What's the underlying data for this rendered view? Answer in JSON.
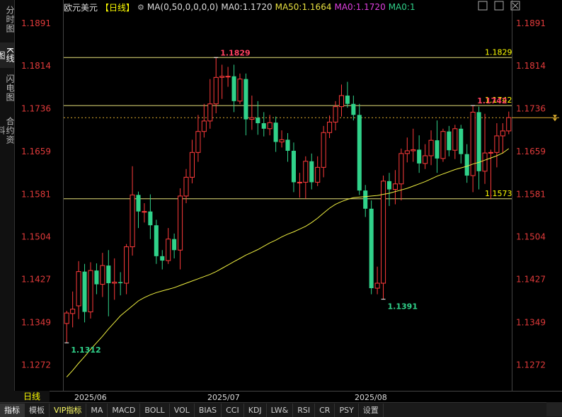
{
  "left_tabs": [
    {
      "label": "分时图",
      "active": false
    },
    {
      "label": "K线图",
      "active": true
    },
    {
      "label": "闪电图",
      "active": false
    },
    {
      "label": "合约资料",
      "active": false
    }
  ],
  "header": {
    "name": "欧元美元",
    "period": "【日线】",
    "ma_label": "MA(0,50,0,0,0,0)",
    "ma0_a": "MA0:1.1720",
    "ma50": "MA50:1.1664",
    "ma0_b": "MA0:1.1720",
    "ma0_c": "MA0:1"
  },
  "window_icons": [
    "maximize-icon",
    "restore-icon",
    "close-icon"
  ],
  "period_label": "日线",
  "bottom_tabs": [
    "指标",
    "模板",
    "VIP指标",
    "MA",
    "MACD",
    "BOLL",
    "VOL",
    "BIAS",
    "CCI",
    "KDJ",
    "LW&",
    "RSI",
    "CR",
    "PSY",
    "设置"
  ],
  "colors": {
    "up": "#ff3b3b",
    "down": "#30d28a",
    "ma": "#f0f040",
    "axis": "#e03a3a",
    "hline": "#e6e07a",
    "label_up": "#ff4060",
    "label_down": "#30d28a"
  },
  "chart_data": {
    "type": "candlestick",
    "y_ticks": [
      "1.1891",
      "1.1814",
      "1.1736",
      "1.1659",
      "1.1581",
      "1.1504",
      "1.1427",
      "1.1349",
      "1.1272"
    ],
    "ylim": [
      1.1235,
      1.192
    ],
    "x_labels": [
      "2025/06",
      "2025/07",
      "2025/08"
    ],
    "hlines": [
      {
        "value": 1.1829,
        "label": "1.1829"
      },
      {
        "value": 1.1742,
        "label": "1.1742"
      },
      {
        "value": 1.1573,
        "label": "1.1573"
      }
    ],
    "current_price": 1.172,
    "annotations": [
      {
        "text": "1.1829",
        "type": "high"
      },
      {
        "text": "1.1742",
        "type": "high"
      },
      {
        "text": "1.1391",
        "type": "low"
      },
      {
        "text": "1.1312",
        "type": "low"
      }
    ],
    "candles": [
      [
        1.1347,
        1.1366,
        1.1312,
        1.137
      ],
      [
        1.1365,
        1.1373,
        1.134,
        1.1405
      ],
      [
        1.1379,
        1.1441,
        1.1355,
        1.146
      ],
      [
        1.1441,
        1.1368,
        1.1349,
        1.1455
      ],
      [
        1.1368,
        1.1443,
        1.1356,
        1.1458
      ],
      [
        1.1443,
        1.1418,
        1.14,
        1.1456
      ],
      [
        1.1418,
        1.1452,
        1.1395,
        1.1475
      ],
      [
        1.1452,
        1.142,
        1.136,
        1.148
      ],
      [
        1.142,
        1.1422,
        1.139,
        1.1465
      ],
      [
        1.1422,
        1.142,
        1.1398,
        1.144
      ],
      [
        1.142,
        1.1486,
        1.14,
        1.1491
      ],
      [
        1.1486,
        1.158,
        1.147,
        1.1632
      ],
      [
        1.158,
        1.155,
        1.152,
        1.1586
      ],
      [
        1.155,
        1.155,
        1.153,
        1.1565
      ],
      [
        1.155,
        1.1525,
        1.15,
        1.1581
      ],
      [
        1.1525,
        1.1469,
        1.1455,
        1.1535
      ],
      [
        1.1469,
        1.1461,
        1.1445,
        1.148
      ],
      [
        1.1461,
        1.15,
        1.1455,
        1.152
      ],
      [
        1.15,
        1.148,
        1.1465,
        1.151
      ],
      [
        1.148,
        1.1578,
        1.1445,
        1.1592
      ],
      [
        1.1578,
        1.1612,
        1.1565,
        1.1627
      ],
      [
        1.1612,
        1.1657,
        1.1601,
        1.168
      ],
      [
        1.1657,
        1.1695,
        1.164,
        1.1725
      ],
      [
        1.1695,
        1.1714,
        1.1684,
        1.1745
      ],
      [
        1.1714,
        1.1745,
        1.17,
        1.179
      ],
      [
        1.1745,
        1.1793,
        1.1728,
        1.1829
      ],
      [
        1.1793,
        1.1795,
        1.1754,
        1.1816
      ],
      [
        1.1795,
        1.1795,
        1.1776,
        1.1812
      ],
      [
        1.1795,
        1.175,
        1.173,
        1.1816
      ],
      [
        1.175,
        1.179,
        1.1745,
        1.18
      ],
      [
        1.179,
        1.1717,
        1.1688,
        1.18
      ],
      [
        1.1717,
        1.172,
        1.1698,
        1.176
      ],
      [
        1.172,
        1.171,
        1.1689,
        1.175
      ],
      [
        1.171,
        1.17,
        1.1686,
        1.173
      ],
      [
        1.17,
        1.1711,
        1.1688,
        1.1725
      ],
      [
        1.1711,
        1.1676,
        1.1658,
        1.1722
      ],
      [
        1.1676,
        1.168,
        1.1666,
        1.1697
      ],
      [
        1.168,
        1.166,
        1.164,
        1.1692
      ],
      [
        1.166,
        1.1603,
        1.1585,
        1.1675
      ],
      [
        1.1603,
        1.1603,
        1.1575,
        1.162
      ],
      [
        1.1603,
        1.1641,
        1.1573,
        1.165
      ],
      [
        1.1641,
        1.1603,
        1.159,
        1.1655
      ],
      [
        1.1603,
        1.163,
        1.1596,
        1.165
      ],
      [
        1.163,
        1.1693,
        1.1612,
        1.1705
      ],
      [
        1.1693,
        1.1712,
        1.1683,
        1.1724
      ],
      [
        1.1712,
        1.174,
        1.1697,
        1.175
      ],
      [
        1.174,
        1.176,
        1.1722,
        1.178
      ],
      [
        1.176,
        1.1745,
        1.1738,
        1.1785
      ],
      [
        1.1745,
        1.1725,
        1.1715,
        1.176
      ],
      [
        1.1725,
        1.1588,
        1.158,
        1.1745
      ],
      [
        1.1588,
        1.1555,
        1.154,
        1.1598
      ],
      [
        1.1555,
        1.1411,
        1.14,
        1.157
      ],
      [
        1.1411,
        1.142,
        1.14,
        1.145
      ],
      [
        1.142,
        1.1605,
        1.1391,
        1.1615
      ],
      [
        1.1605,
        1.159,
        1.156,
        1.162
      ],
      [
        1.159,
        1.16,
        1.1563,
        1.1625
      ],
      [
        1.16,
        1.1655,
        1.157,
        1.1664
      ],
      [
        1.1655,
        1.166,
        1.1639,
        1.1684
      ],
      [
        1.166,
        1.1662,
        1.164,
        1.17
      ],
      [
        1.1662,
        1.1637,
        1.162,
        1.1688
      ],
      [
        1.1637,
        1.1651,
        1.1627,
        1.1672
      ],
      [
        1.1651,
        1.1679,
        1.1634,
        1.1697
      ],
      [
        1.1679,
        1.1646,
        1.162,
        1.1715
      ],
      [
        1.1646,
        1.1695,
        1.164,
        1.17
      ],
      [
        1.1695,
        1.1661,
        1.165,
        1.1705
      ],
      [
        1.1661,
        1.17,
        1.1645,
        1.1707
      ],
      [
        1.17,
        1.1654,
        1.1637,
        1.1707
      ],
      [
        1.1654,
        1.1615,
        1.1602,
        1.1672
      ],
      [
        1.1615,
        1.173,
        1.1585,
        1.1742
      ],
      [
        1.173,
        1.1623,
        1.159,
        1.174
      ],
      [
        1.1623,
        1.1656,
        1.16,
        1.1727
      ],
      [
        1.1656,
        1.1657,
        1.1573,
        1.1662
      ],
      [
        1.1657,
        1.1687,
        1.163,
        1.171
      ],
      [
        1.1687,
        1.1696,
        1.1655,
        1.171
      ],
      [
        1.1696,
        1.172,
        1.169,
        1.1731
      ]
    ],
    "ma50": [
      1.125,
      1.1262,
      1.1275,
      1.1287,
      1.13,
      1.1312,
      1.1324,
      1.1337,
      1.1349,
      1.1361,
      1.137,
      1.1379,
      1.1388,
      1.1394,
      1.1399,
      1.1403,
      1.1406,
      1.1409,
      1.1412,
      1.1416,
      1.142,
      1.1424,
      1.1428,
      1.1432,
      1.1436,
      1.1441,
      1.1447,
      1.1453,
      1.1459,
      1.1465,
      1.1471,
      1.1476,
      1.1481,
      1.1487,
      1.1493,
      1.1498,
      1.1504,
      1.1509,
      1.1513,
      1.1518,
      1.1523,
      1.153,
      1.1538,
      1.1547,
      1.1556,
      1.1563,
      1.1568,
      1.1572,
      1.1575,
      1.1576,
      1.1577,
      1.1578,
      1.1579,
      1.1581,
      1.1583,
      1.1586,
      1.1589,
      1.1592,
      1.1596,
      1.16,
      1.1604,
      1.1609,
      1.1614,
      1.1618,
      1.1622,
      1.1626,
      1.1629,
      1.1632,
      1.1636,
      1.1639,
      1.1643,
      1.1647,
      1.1651,
      1.1656,
      1.1664
    ]
  }
}
